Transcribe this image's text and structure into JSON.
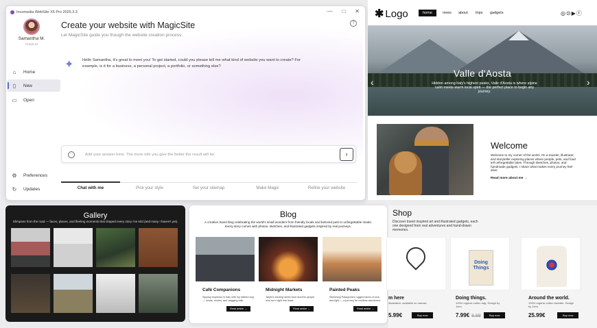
{
  "window": {
    "title": "Incomedia WebSite X5 Pro 2025.3.3",
    "controls": [
      "—",
      "□",
      "✕"
    ]
  },
  "user": {
    "name": "Samantha M.",
    "credits": "Credit 32"
  },
  "sidebar": {
    "items": [
      {
        "label": "Home",
        "icon": "home-icon"
      },
      {
        "label": "New",
        "icon": "new-file-icon",
        "active": true
      },
      {
        "label": "Open",
        "icon": "folder-icon"
      }
    ],
    "bottom": [
      {
        "label": "Preferences",
        "icon": "gear-icon"
      },
      {
        "label": "Updates",
        "icon": "refresh-icon"
      }
    ]
  },
  "main": {
    "title": "Create your website with MagicSite",
    "subtitle": "Let MagicSite guide you though the website creation process.",
    "bot_message": "Hello Samantha, it's great to meet you! To get started, could you please tell me what kind of website you want to create? For example, is it for a business, a personal project, a portfolio, or something else?",
    "input_placeholder": "Add your answer here. The more info you give the better the result will be.",
    "steps": [
      "Chat with me",
      "Pick your style",
      "Set your sitemap",
      "Make Magic",
      "Refine your website"
    ],
    "active_step": 0
  },
  "site": {
    "logo": "Logo",
    "nav": [
      "home",
      "news",
      "about",
      "trips",
      "gadgets"
    ],
    "hero_title": "Valle d'Aosta",
    "hero_text": "Hidden among Italy's highest peaks, Valle d'Aosta is where alpine calm meets warm local spirit — the perfect place to begin any journey.",
    "welcome_title": "Welcome",
    "welcome_text": "Welcome to my corner of the world. I'm a traveler, illustrator, and storyteller exploring places where people, pets, and food tell unforgettable tales. Through sketches, photos, and handmade gadgets, I share what makes every journey feel alive.",
    "read_more": "Read more about me →"
  },
  "gallery": {
    "title": "Gallery",
    "subtitle": "Glimpses from the road — faces, places, and fleeting moments that shaped every story I've told (and many I haven't yet)."
  },
  "blog": {
    "title": "Blog",
    "subtitle": "A creative travel blog celebrating the world's small wonders from friendly locals and beloved pets to unforgettable meals. Every story comes with photos, sketches, and illustrated gadgets inspired by real journeys.",
    "posts": [
      {
        "title": "Café Companions",
        "text": "Sipping espresso in Italy with my faithful dog — locals, stories, and wagging tails.",
        "button": "Read article →"
      },
      {
        "title": "Midnight Markets",
        "text": "Taipei's sizzling street food and the people who turn night into feast.",
        "button": "Read article →"
      },
      {
        "title": "Painted Peaks",
        "text": "Sketching Patagonia's rugged faces of rock and light — a journey for restless wanderers.",
        "button": "Read article →"
      }
    ]
  },
  "shop": {
    "title": "Shop",
    "subtitle": "Discover travel inspired art and illustrated gadgets, each one designed from real adventures and hand-drawn memories.",
    "products": [
      {
        "name": "m here",
        "desc": "illustration. available on canvas.",
        "price": "5.99€",
        "old_price": "",
        "button": "Buy now"
      },
      {
        "name": "Doing things.",
        "desc": "100% organic cotton bag. Design by John.",
        "price": "7.99€",
        "old_price": "8.99",
        "button": "Buy now"
      },
      {
        "name": "Around the world.",
        "desc": "100% organic cotton sweater. Design by John.",
        "price": "25.99€",
        "old_price": "",
        "button": "Buy now"
      }
    ],
    "bag_print": "Doing Things"
  }
}
